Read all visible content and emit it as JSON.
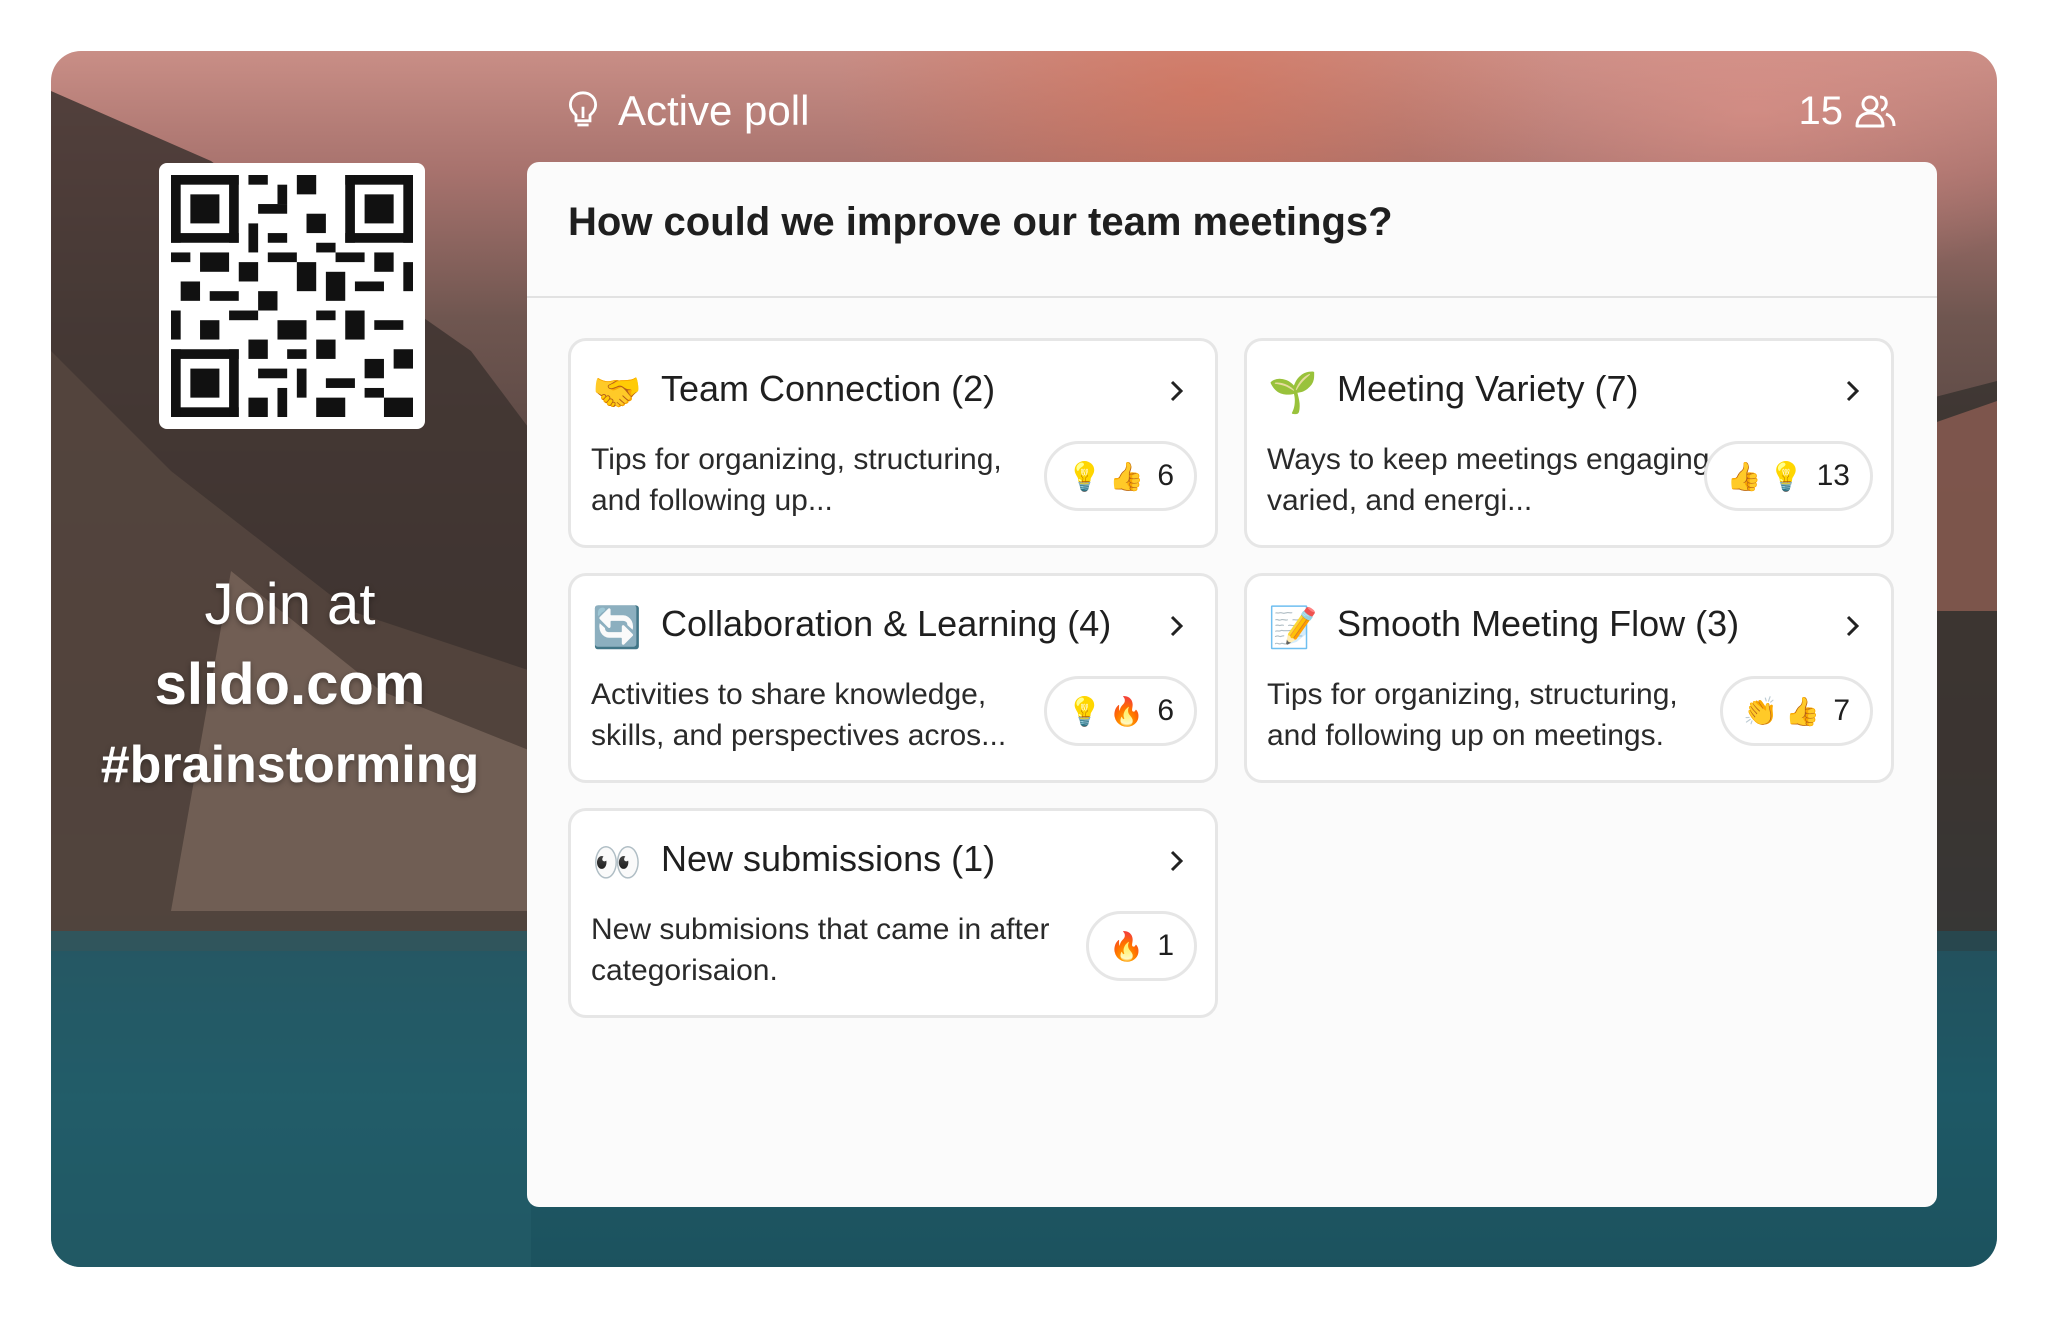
{
  "sidebar": {
    "join_at": "Join at",
    "url": "slido.com",
    "code": "#brainstorming"
  },
  "header": {
    "icon": "lightbulb-icon",
    "title": "Active poll",
    "participant_count": "15",
    "participants_icon": "users-icon"
  },
  "question": "How could we improve our team meetings?",
  "cards": [
    {
      "emoji": "🤝",
      "title": "Team Connection (2)",
      "description": "Tips for organizing, structuring, and following up...",
      "reactions": [
        "💡",
        "👍"
      ],
      "count": "6"
    },
    {
      "emoji": "🌱",
      "title": "Meeting Variety (7)",
      "description": "Ways to keep meetings engaging varied, and energi...",
      "reactions": [
        "👍",
        "💡"
      ],
      "count": "13"
    },
    {
      "emoji": "🔄",
      "title": "Collaboration & Learning (4)",
      "description": "Activities to share knowledge, skills, and perspectives acros...",
      "reactions": [
        "💡",
        "🔥"
      ],
      "count": "6"
    },
    {
      "emoji": "📝",
      "title": "Smooth Meeting Flow (3)",
      "description": "Tips for organizing, structuring, and following up on meetings.",
      "reactions": [
        "👏",
        "👍"
      ],
      "count": "7"
    },
    {
      "emoji": "👀",
      "title": "New submissions (1)",
      "description": "New submisions that came in after categorisaion.",
      "reactions": [
        "🔥"
      ],
      "count": "1"
    }
  ]
}
